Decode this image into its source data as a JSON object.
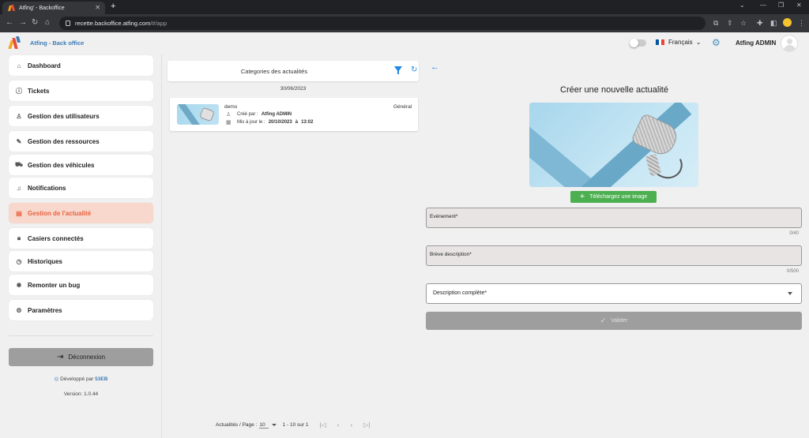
{
  "browser": {
    "tab_title": "Atfing' - Backoffice",
    "url_host": "recette.backoffice.atfing.com",
    "url_path": "/#/app"
  },
  "header": {
    "app_title": "Atfing - Back office",
    "language": "Français",
    "user_name": "Atfing ADMIN"
  },
  "sidebar": {
    "items": [
      {
        "label": "Dashboard",
        "icon": "home-icon"
      },
      {
        "label": "Tickets",
        "icon": "alert-circle-icon"
      },
      {
        "label": "Gestion des utilisateurs",
        "icon": "user-icon"
      },
      {
        "label": "Gestion des ressources",
        "icon": "pencil-icon"
      },
      {
        "label": "Gestion des véhicules",
        "icon": "truck-icon"
      },
      {
        "label": "Notifications",
        "icon": "bell-icon"
      },
      {
        "label": "Gestion de l'actualité",
        "icon": "newspaper-icon"
      },
      {
        "label": "Casiers connectés",
        "icon": "lock-icon"
      },
      {
        "label": "Historiques",
        "icon": "history-icon"
      },
      {
        "label": "Remonter un bug",
        "icon": "bug-icon"
      },
      {
        "label": "Paramètres",
        "icon": "settings-icon"
      }
    ],
    "active_index": 6,
    "logout_label": "Déconnexion",
    "dev_prefix": "Développé par",
    "dev_brand": "53EB",
    "version": "Version: 1.0.44"
  },
  "list": {
    "header_title": "Categories des actualités",
    "group_date": "30/06/2023",
    "items": [
      {
        "name": "demo",
        "category": "Général",
        "created_by_label": "Créé par :",
        "created_by": "Atfing ADMIN",
        "updated_label": "Mis à jour le :",
        "updated_date": "20/10/2023",
        "updated_sep": "à",
        "updated_time": "13:02"
      }
    ],
    "pager": {
      "per_page_label": "Actualités / Page :",
      "per_page_value": "10",
      "range": "1 - 10 sur 1"
    }
  },
  "form": {
    "title": "Créer une nouvelle actualité",
    "upload_label": "Téléchargez une image",
    "event_label": "Evénement*",
    "event_counter": "0/40",
    "short_desc_label": "Brève description*",
    "short_desc_counter": "0/500",
    "full_desc_label": "Description complète*",
    "submit_label": "Valider"
  },
  "colors": {
    "accent_blue": "#1e88e5",
    "active_bg": "#f8d7cc",
    "active_text": "#e8633f",
    "upload_green": "#4caf50"
  }
}
